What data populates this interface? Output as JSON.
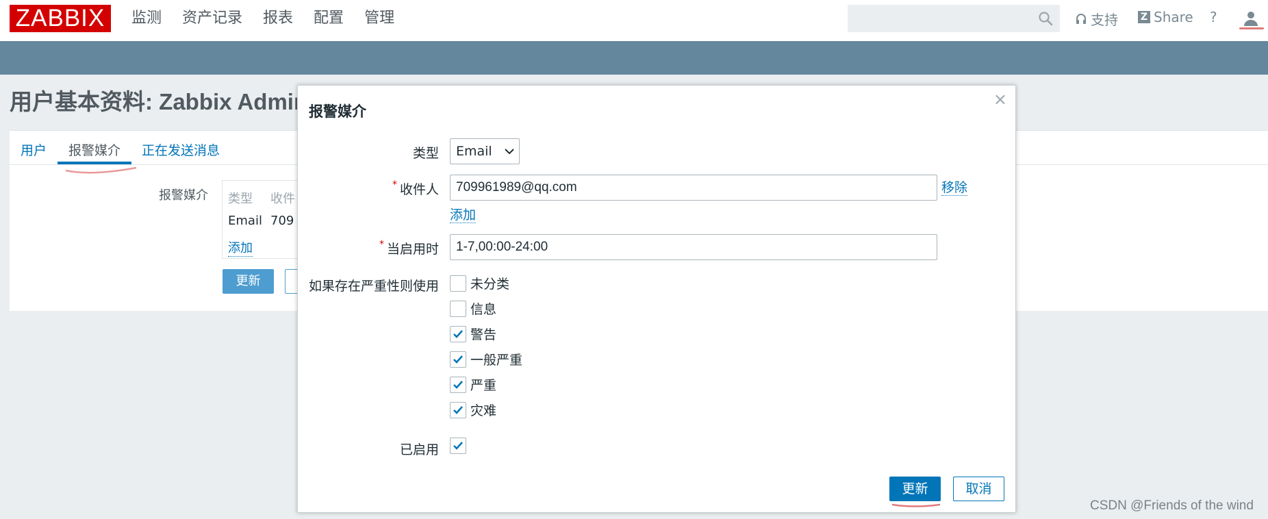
{
  "header": {
    "logo": "ZABBIX",
    "menu": [
      "监测",
      "资产记录",
      "报表",
      "配置",
      "管理"
    ],
    "search_placeholder": "",
    "support_label": "支持",
    "share_label": "Share",
    "share_badge": "Z",
    "help_label": "?"
  },
  "page": {
    "title": "用户基本资料: Zabbix Adminis",
    "tabs": [
      "用户",
      "报警媒介",
      "正在发送消息"
    ],
    "active_tab": "报警媒介"
  },
  "background_form": {
    "media_label": "报警媒介",
    "table_headers": [
      "类型",
      "收件"
    ],
    "row_type": "Email",
    "row_sendto": "709",
    "add_link": "添加",
    "update_button": "更新"
  },
  "modal": {
    "title": "报警媒介",
    "close": "×",
    "type_label": "类型",
    "type_value": "Email",
    "sendto_label": "收件人",
    "sendto_value": "709961989@qq.com",
    "remove_link": "移除",
    "add_link": "添加",
    "when_active_label": "当启用时",
    "when_active_value": "1-7,00:00-24:00",
    "severity_label": "如果存在严重性则使用",
    "severities": [
      {
        "label": "未分类",
        "checked": false
      },
      {
        "label": "信息",
        "checked": false
      },
      {
        "label": "警告",
        "checked": true
      },
      {
        "label": "一般严重",
        "checked": true
      },
      {
        "label": "严重",
        "checked": true
      },
      {
        "label": "灾难",
        "checked": true
      }
    ],
    "enabled_label": "已启用",
    "enabled_checked": true,
    "update_button": "更新",
    "cancel_button": "取消"
  },
  "watermark": "CSDN @Friends of the wind",
  "colors": {
    "brand_red": "#d40000",
    "primary_blue": "#0275b8",
    "header_bar": "#64879e"
  }
}
